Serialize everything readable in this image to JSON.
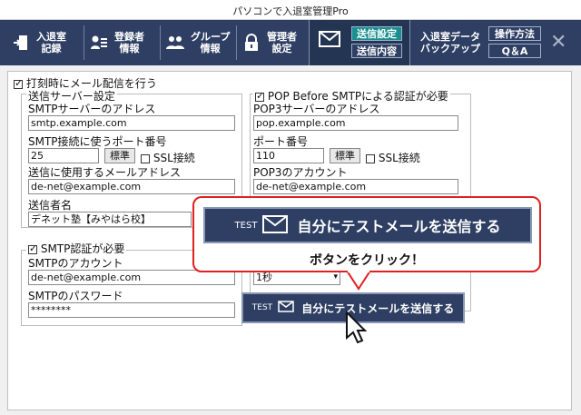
{
  "window": {
    "title": "パソコンで入退室管理Pro"
  },
  "toolbar": {
    "entry_record": "入退室\n記録",
    "registrant_info": "登録者\n情報",
    "group_info": "グループ\n情報",
    "admin_settings": "管理者\n設定",
    "send_settings": "送信設定",
    "send_content": "送信内容",
    "data_backup": "入退室データ\nバックアップ",
    "how_to": "操作方法",
    "qa": "Q＆A"
  },
  "form": {
    "notify_checkbox_label": "打刻時にメール配信を行う",
    "server_group_label": "送信サーバー設定",
    "smtp_address_label": "SMTPサーバーのアドレス",
    "smtp_address_value": "smtp.example.com",
    "smtp_port_label": "SMTP接続に使うポート番号",
    "smtp_port_value": "25",
    "standard_button": "標準",
    "ssl_label": "SSL接続",
    "sender_mail_label": "送信に使用するメールアドレス",
    "sender_mail_value": "de-net@example.com",
    "sender_name_label": "送信者名",
    "sender_name_value": "デネット塾【みやはら校】",
    "smtp_auth_label": "SMTP認証が必要",
    "smtp_account_label": "SMTPのアカウント",
    "smtp_account_value": "de-net@example.com",
    "smtp_password_label": "SMTPのパスワード",
    "smtp_password_value": "********",
    "pop_checkbox_label": "POP Before SMTPによる認証が必要",
    "pop3_address_label": "POP3サーバーのアドレス",
    "pop3_address_value": "pop.example.com",
    "port_label": "ポート番号",
    "pop3_port_value": "110",
    "pop3_account_label": "POP3のアカウント",
    "pop3_account_value": "de-net@example.com",
    "wait_select_value": "1秒"
  },
  "callout": {
    "test_label": "TEST",
    "big_button_text": "自分にテストメールを送信する",
    "instruction": "ボタンをクリック！"
  },
  "send_button": {
    "test_label": "TEST",
    "text": "自分にテストメールを送信する"
  },
  "colors": {
    "toolbar": "#2e3f63",
    "active_tab": "#1a8f8f",
    "callout_border": "#e02020"
  }
}
